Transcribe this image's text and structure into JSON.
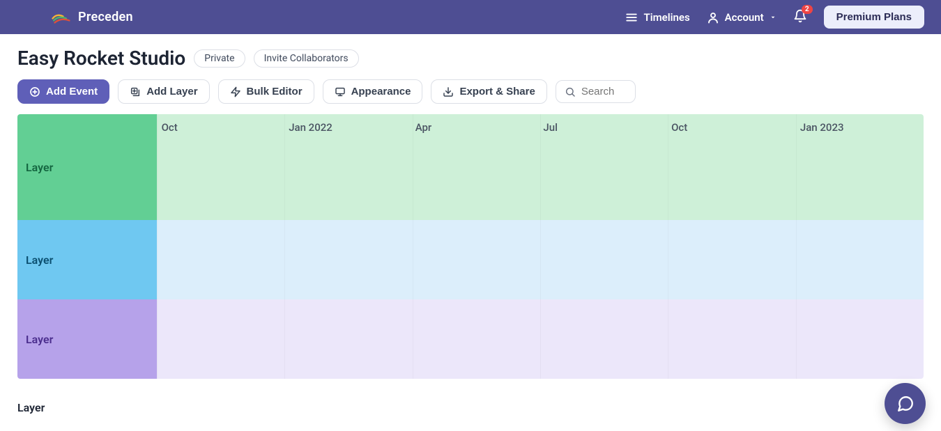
{
  "nav": {
    "brand": "Preceden",
    "timelines": "Timelines",
    "account": "Account",
    "notification_count": "2",
    "premium": "Premium Plans"
  },
  "header": {
    "title": "Easy Rocket Studio",
    "privacy": "Private",
    "invite": "Invite Collaborators"
  },
  "toolbar": {
    "add_event": "Add Event",
    "add_layer": "Add Layer",
    "bulk_editor": "Bulk Editor",
    "appearance": "Appearance",
    "export_share": "Export & Share",
    "search_placeholder": "Search"
  },
  "timeline": {
    "dates": [
      "Oct",
      "Jan 2022",
      "Apr",
      "Jul",
      "Oct",
      "Jan 2023"
    ],
    "layers": [
      {
        "label": "Layer"
      },
      {
        "label": "Layer"
      },
      {
        "label": "Layer"
      }
    ],
    "bottom_label": "Layer"
  }
}
